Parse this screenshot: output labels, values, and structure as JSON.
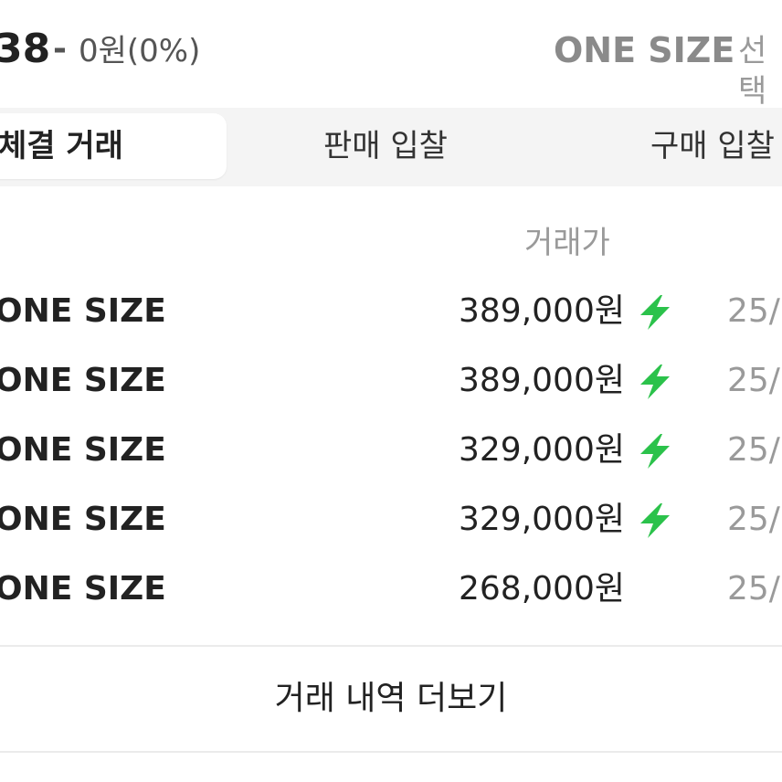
{
  "price_header": {
    "model_code": "38",
    "dash": "-",
    "change": "0원(0%)",
    "size_option": "ONE SIZE",
    "select_label": "선택"
  },
  "tabs": [
    {
      "label": "체결 거래",
      "active": true
    },
    {
      "label": "판매 입찰",
      "active": false
    },
    {
      "label": "구매 입찰",
      "active": false
    }
  ],
  "table": {
    "price_header": "거래가",
    "rows": [
      {
        "size": "ONE SIZE",
        "price": "389,000원",
        "quick": true,
        "date": "25/"
      },
      {
        "size": "ONE SIZE",
        "price": "389,000원",
        "quick": true,
        "date": "25/"
      },
      {
        "size": "ONE SIZE",
        "price": "329,000원",
        "quick": true,
        "date": "25/"
      },
      {
        "size": "ONE SIZE",
        "price": "329,000원",
        "quick": true,
        "date": "25/"
      },
      {
        "size": "ONE SIZE",
        "price": "268,000원",
        "quick": false,
        "date": "25/"
      }
    ]
  },
  "more_button": "거래 내역 더보기",
  "colors": {
    "quick_bolt": "#2bc24b",
    "tab_bar_bg": "#f4f4f4",
    "muted_text": "#9a9a9a"
  },
  "icons": {
    "quick_delivery": "lightning-bolt-icon"
  }
}
